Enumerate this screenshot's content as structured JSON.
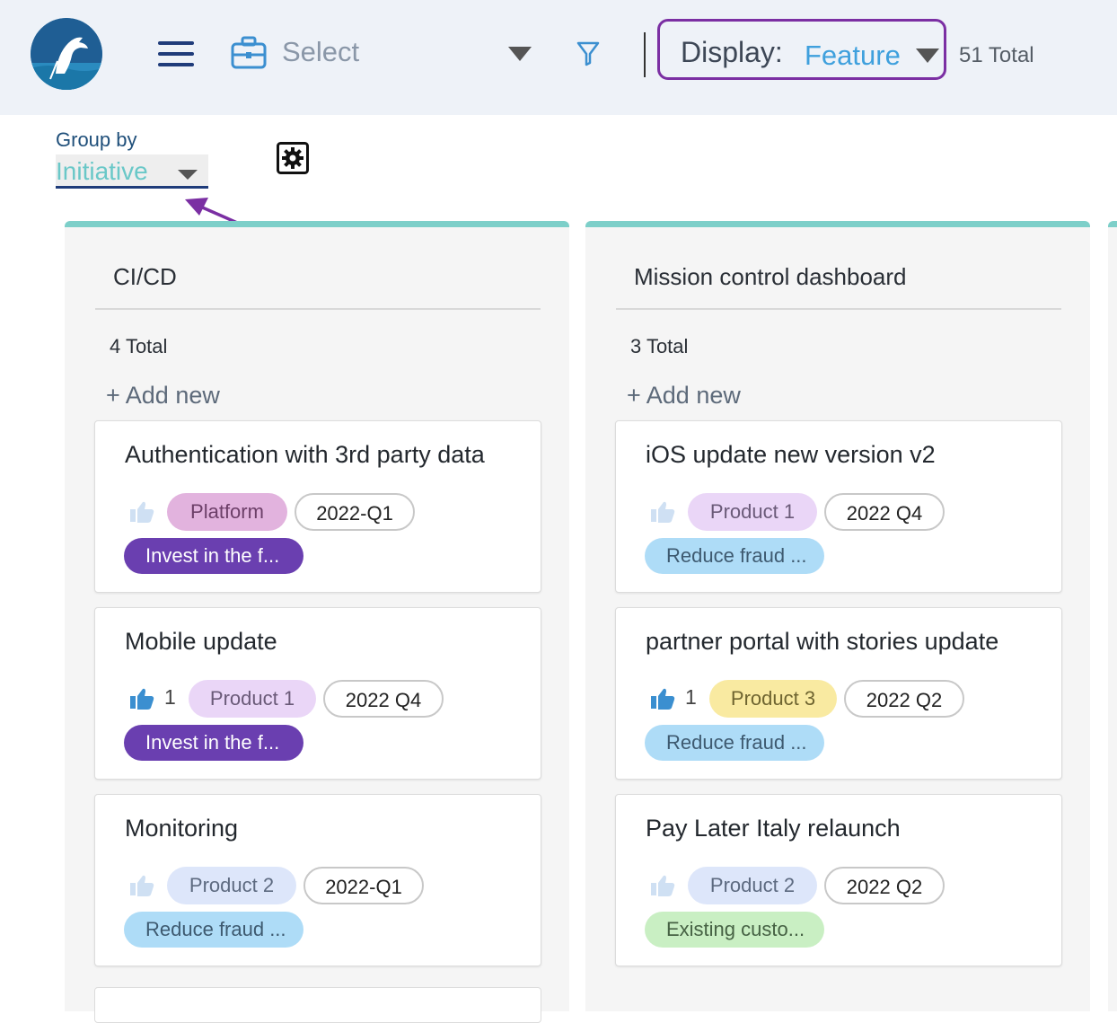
{
  "header": {
    "logo": "dragon-logo",
    "select_label": "Select",
    "display_label": "Display:",
    "display_value": "Feature",
    "total": "51 Total",
    "icons": [
      "menu-icon",
      "briefcase-icon",
      "chevron-down-icon",
      "filter-icon"
    ],
    "colors": {
      "background": "#eef2f8",
      "highlight_border": "#7b2fa3",
      "display_value": "#3fa0dd"
    }
  },
  "groupby": {
    "label": "Group by",
    "value": "Initiative",
    "settings_icon": "gear-icon"
  },
  "columns": [
    {
      "title": "CI/CD",
      "total": "4 Total",
      "add_new": "+ Add new",
      "cards": [
        {
          "title": "Authentication with 3rd party data",
          "likes": "",
          "liked": false,
          "product": "Platform",
          "quarter": "2022-Q1",
          "initiative": "Invest in the f..."
        },
        {
          "title": "Mobile update",
          "likes": "1",
          "liked": true,
          "product": "Product 1",
          "quarter": "2022 Q4",
          "initiative": "Invest in the f..."
        },
        {
          "title": "Monitoring",
          "likes": "",
          "liked": false,
          "product": "Product 2",
          "quarter": "2022-Q1",
          "initiative": "Reduce fraud ..."
        }
      ]
    },
    {
      "title": "Mission control dashboard",
      "total": "3 Total",
      "add_new": "+ Add new",
      "cards": [
        {
          "title": "iOS update new version v2",
          "likes": "",
          "liked": false,
          "product": "Product 1",
          "quarter": "2022 Q4",
          "initiative": "Reduce fraud ..."
        },
        {
          "title": "partner portal with stories update",
          "likes": "1",
          "liked": true,
          "product": "Product 3",
          "quarter": "2022 Q2",
          "initiative": "Reduce fraud ..."
        },
        {
          "title": "Pay Later Italy relaunch",
          "likes": "",
          "liked": false,
          "product": "Product 2",
          "quarter": "2022 Q2",
          "initiative": "Existing custo..."
        }
      ]
    }
  ],
  "colors": {
    "column_accent": "#7dcfc9",
    "invest_tag": "#6a3fb0",
    "fraud_tag": "#aedcf7",
    "existing_tag": "#c9efc3",
    "annotation_arrow": "#7b2fa3"
  }
}
